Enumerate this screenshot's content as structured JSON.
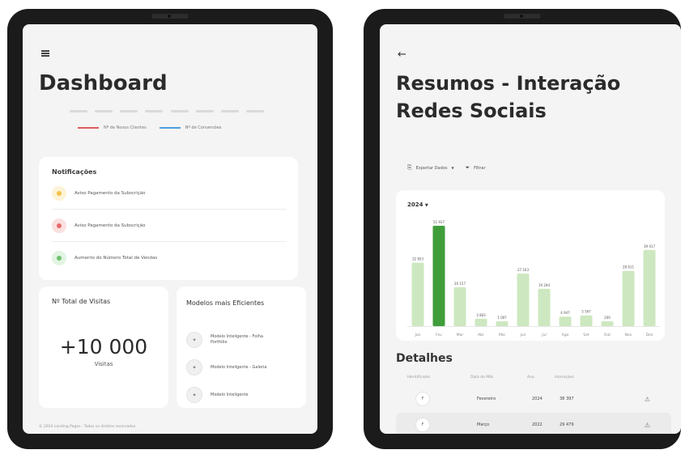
{
  "dashboard": {
    "title": "Dashboard",
    "legend": [
      {
        "label": "Nº de Novos Clientes",
        "color": "#e05a5a"
      },
      {
        "label": "Nº de Conversões",
        "color": "#4a9ee0"
      }
    ],
    "notifications": {
      "title": "Notificações",
      "items": [
        {
          "text": "Aviso Pagamento da Subscrição",
          "color": "#f2c24a",
          "bg": "#fdf3d6"
        },
        {
          "text": "Aviso Pagamento da Subscrição",
          "color": "#e66a6a",
          "bg": "#fbe0e0"
        },
        {
          "text": "Aumento do Número Total de Vendas",
          "color": "#6fc26f",
          "bg": "#e2f4e2"
        }
      ]
    },
    "visits": {
      "label": "Nº Total de Visitas",
      "value": "+10 000",
      "unit": "Visitas"
    },
    "models": {
      "title": "Modelos mais Eficientes",
      "items": [
        {
          "text": "Modelo Inteligente - Folha Portfólio"
        },
        {
          "text": "Modelo Inteligente - Galeria"
        },
        {
          "text": "Modelo Inteligente"
        }
      ]
    },
    "footer": "© 2024 Landing Pages · Todos os direitos reservados"
  },
  "summary": {
    "title": "Resumos - Interação Redes Sociais",
    "toolbar": {
      "export": "Exportar Dados",
      "filter": "Filtrar"
    },
    "year": "2024",
    "details": {
      "title": "Detalhes",
      "columns": [
        "Identificador",
        "Data do Mês",
        "Ano",
        "Interações"
      ],
      "rows": [
        {
          "avatar": "F",
          "month": "Fevereiro",
          "year": "2024",
          "value": "38 397"
        },
        {
          "avatar": "F",
          "month": "Março",
          "year": "2022",
          "value": "29 479"
        }
      ]
    }
  },
  "chart_data": {
    "type": "bar",
    "title": "",
    "categories": [
      "Jan",
      "Fev",
      "Mar",
      "Abr",
      "Mai",
      "Jun",
      "Jul",
      "Ago",
      "Set",
      "Out",
      "Nov",
      "Dez"
    ],
    "values": [
      32853,
      51937,
      20157,
      3803,
      1007,
      27163,
      19294,
      4947,
      5567,
      200,
      28611,
      39417
    ],
    "labels": [
      "32 853",
      "51 937",
      "20 157",
      "3 803",
      "1 007",
      "27 163",
      "19 294",
      "4 947",
      "5 567",
      "200",
      "28 611",
      "39 417"
    ],
    "highlight_index": 1,
    "colors": {
      "bar": "#cde8c0",
      "highlight": "#3f9e3a"
    },
    "xlabel": "",
    "ylabel": ""
  }
}
